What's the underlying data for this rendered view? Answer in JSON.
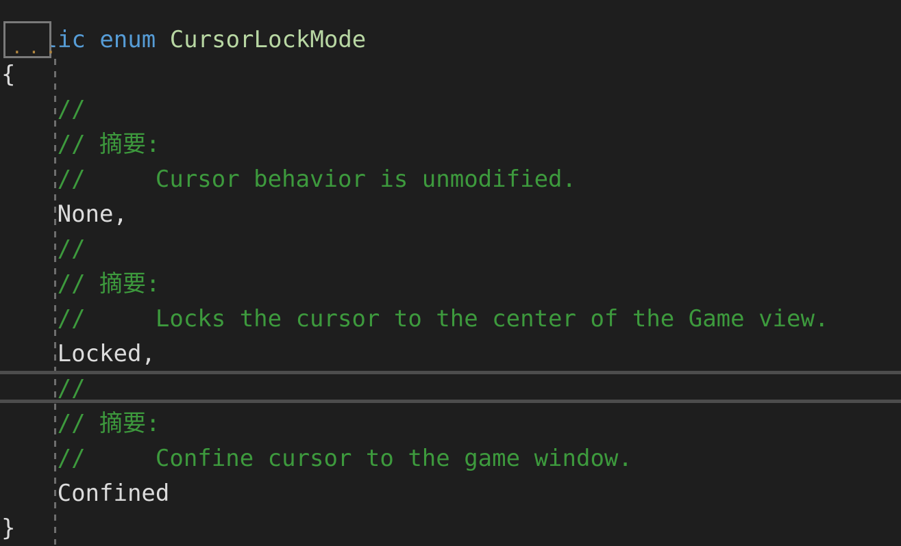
{
  "editor": {
    "language": "csharp",
    "theme_background": "#1e1e1e",
    "colors": {
      "keyword": "#569cd6",
      "type": "#b8d7a3",
      "comment": "#3d9a3d",
      "plain_text": "#dcdcdc",
      "indent_guide": "#6e6e6e",
      "current_line_border": "#4d4d4d",
      "collapsed_region_border": "#7a7a7a"
    },
    "collapsed_region": {
      "label": "...",
      "tooltip_hint": "..."
    },
    "lines": [
      {
        "index": 0,
        "indent": 0,
        "tokens": [
          {
            "text": "public",
            "kind": "keyword"
          },
          {
            "text": " ",
            "kind": "plain"
          },
          {
            "text": "enum",
            "kind": "keyword"
          },
          {
            "text": " ",
            "kind": "plain"
          },
          {
            "text": "CursorLockMode",
            "kind": "type"
          }
        ]
      },
      {
        "index": 1,
        "indent": 0,
        "tokens": [
          {
            "text": "{",
            "kind": "punct"
          }
        ]
      },
      {
        "index": 2,
        "indent": 4,
        "tokens": [
          {
            "text": "//",
            "kind": "comment"
          }
        ]
      },
      {
        "index": 3,
        "indent": 4,
        "tokens": [
          {
            "text": "// 摘要:",
            "kind": "comment"
          }
        ]
      },
      {
        "index": 4,
        "indent": 4,
        "tokens": [
          {
            "text": "//     Cursor behavior is unmodified.",
            "kind": "comment"
          }
        ]
      },
      {
        "index": 5,
        "indent": 4,
        "tokens": [
          {
            "text": "None,",
            "kind": "plain"
          }
        ]
      },
      {
        "index": 6,
        "indent": 4,
        "tokens": [
          {
            "text": "//",
            "kind": "comment"
          }
        ]
      },
      {
        "index": 7,
        "indent": 4,
        "tokens": [
          {
            "text": "// 摘要:",
            "kind": "comment"
          }
        ]
      },
      {
        "index": 8,
        "indent": 4,
        "tokens": [
          {
            "text": "//     Locks the cursor to the center of the Game view.",
            "kind": "comment"
          }
        ]
      },
      {
        "index": 9,
        "indent": 4,
        "tokens": [
          {
            "text": "Locked,",
            "kind": "plain"
          }
        ]
      },
      {
        "index": 10,
        "indent": 4,
        "current": true,
        "tokens": [
          {
            "text": "//",
            "kind": "comment"
          }
        ]
      },
      {
        "index": 11,
        "indent": 4,
        "tokens": [
          {
            "text": "// 摘要:",
            "kind": "comment"
          }
        ]
      },
      {
        "index": 12,
        "indent": 4,
        "tokens": [
          {
            "text": "//     Confine cursor to the game window.",
            "kind": "comment"
          }
        ]
      },
      {
        "index": 13,
        "indent": 4,
        "tokens": [
          {
            "text": "Confined",
            "kind": "plain"
          }
        ]
      },
      {
        "index": 14,
        "indent": 0,
        "tokens": [
          {
            "text": "}",
            "kind": "punct"
          }
        ]
      }
    ]
  }
}
